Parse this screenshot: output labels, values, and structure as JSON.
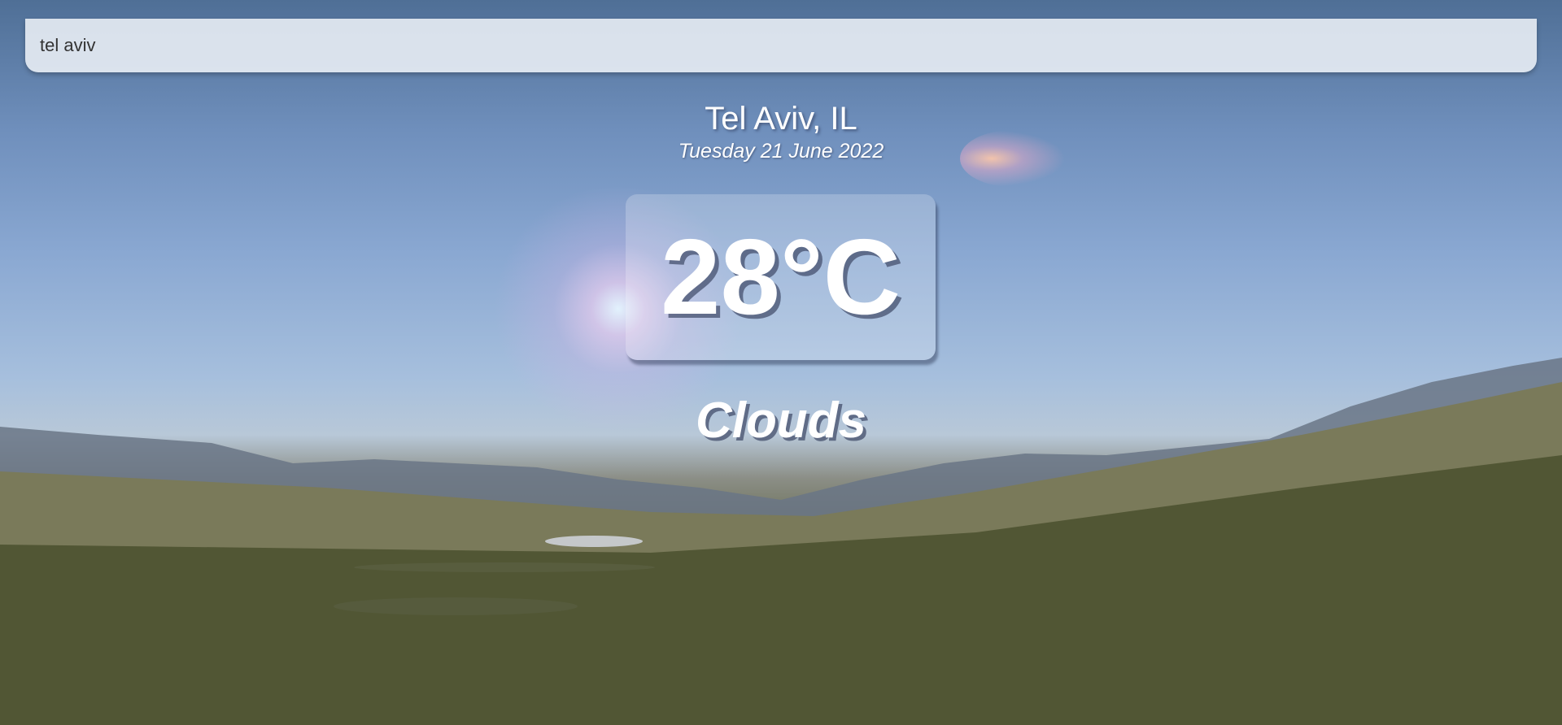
{
  "search": {
    "value": "tel aviv"
  },
  "location": {
    "city": "Tel Aviv, IL",
    "date": "Tuesday 21 June 2022"
  },
  "weather": {
    "temperature": "28°C",
    "condition": "Clouds"
  },
  "background": {
    "sky_color": "#8aa8d2",
    "ground_color": "#3e4426"
  }
}
